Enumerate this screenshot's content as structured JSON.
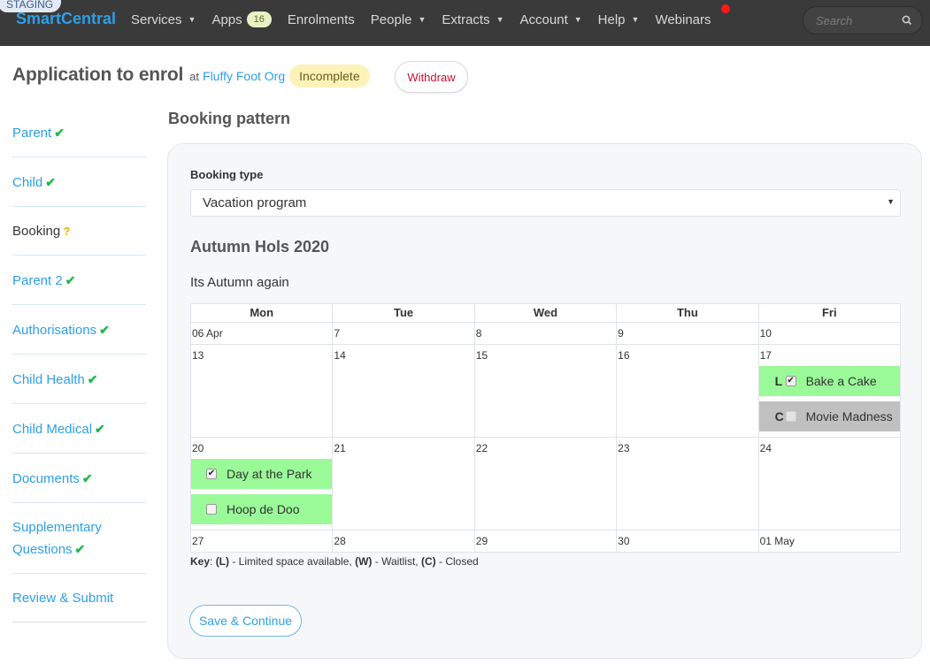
{
  "env_badge": "STAGING",
  "nav": {
    "brand": "SmartCentral",
    "items": [
      {
        "label": "Services",
        "dropdown": true
      },
      {
        "label": "Apps",
        "badge": "16",
        "dropdown": false
      },
      {
        "label": "Enrolments",
        "dropdown": false
      },
      {
        "label": "People",
        "dropdown": true
      },
      {
        "label": "Extracts",
        "dropdown": true
      },
      {
        "label": "Account",
        "dropdown": true
      },
      {
        "label": "Help",
        "dropdown": true
      },
      {
        "label": "Webinars",
        "dropdown": false
      }
    ],
    "search_placeholder": "Search",
    "search_icon": "search-icon",
    "notification_color": "#ff1a1a"
  },
  "header": {
    "title": "Application to enrol",
    "at": "at",
    "org": "Fluffy Foot Org",
    "status": "Incomplete",
    "withdraw": "Withdraw"
  },
  "sidebar": {
    "items": [
      {
        "label": "Parent",
        "status": "complete"
      },
      {
        "label": "Child",
        "status": "complete"
      },
      {
        "label": "Booking",
        "status": "incomplete"
      },
      {
        "label": "Parent 2",
        "status": "complete"
      },
      {
        "label": "Authorisations",
        "status": "complete"
      },
      {
        "label": "Child Health",
        "status": "complete"
      },
      {
        "label": "Child Medical",
        "status": "complete"
      },
      {
        "label": "Documents",
        "status": "complete"
      },
      {
        "label": "Supplementary Questions",
        "status": "complete"
      },
      {
        "label": "Review & Submit",
        "status": "none"
      }
    ],
    "check_glyph": "✔",
    "question_glyph": "?"
  },
  "main": {
    "section_title": "Booking pattern",
    "booking_type_label": "Booking type",
    "booking_type_value": "Vacation program",
    "program_title": "Autumn Hols 2020",
    "program_desc": "Its Autumn again",
    "calendar": {
      "days": [
        "Mon",
        "Tue",
        "Wed",
        "Thu",
        "Fri"
      ],
      "weeks": [
        {
          "dates": [
            "06 Apr",
            "7",
            "8",
            "9",
            "10"
          ],
          "sessions": [
            [],
            [],
            [],
            [],
            []
          ]
        },
        {
          "dates": [
            "13",
            "14",
            "15",
            "16",
            "17"
          ],
          "sessions": [
            [],
            [],
            [],
            [],
            [
              {
                "flag": "L",
                "label": "Bake a Cake",
                "checked": true,
                "state": "available"
              },
              {
                "flag": "C",
                "label": "Movie Madness",
                "checked": false,
                "state": "closed"
              }
            ]
          ]
        },
        {
          "dates": [
            "20",
            "21",
            "22",
            "23",
            "24"
          ],
          "sessions": [
            [
              {
                "flag": "",
                "label": "Day at the Park",
                "checked": true,
                "state": "available"
              },
              {
                "flag": "",
                "label": "Hoop de Doo",
                "checked": false,
                "state": "available"
              }
            ],
            [],
            [],
            [],
            []
          ]
        },
        {
          "dates": [
            "27",
            "28",
            "29",
            "30",
            "01 May"
          ],
          "sessions": [
            [],
            [],
            [],
            [],
            []
          ]
        }
      ]
    },
    "key": {
      "prefix": "Key",
      "entries": [
        {
          "code": "(L)",
          "desc": " - Limited space available, "
        },
        {
          "code": "(W)",
          "desc": " - Waitlist, "
        },
        {
          "code": "(C)",
          "desc": " - Closed"
        }
      ]
    },
    "save_label": "Save & Continue"
  },
  "colors": {
    "accent": "#2d9fe6",
    "available": "#9afa98",
    "closed": "#c0c0c0",
    "complete_check": "#1fb84a",
    "incomplete_mark": "#f0b400",
    "withdraw": "#c8102e"
  }
}
